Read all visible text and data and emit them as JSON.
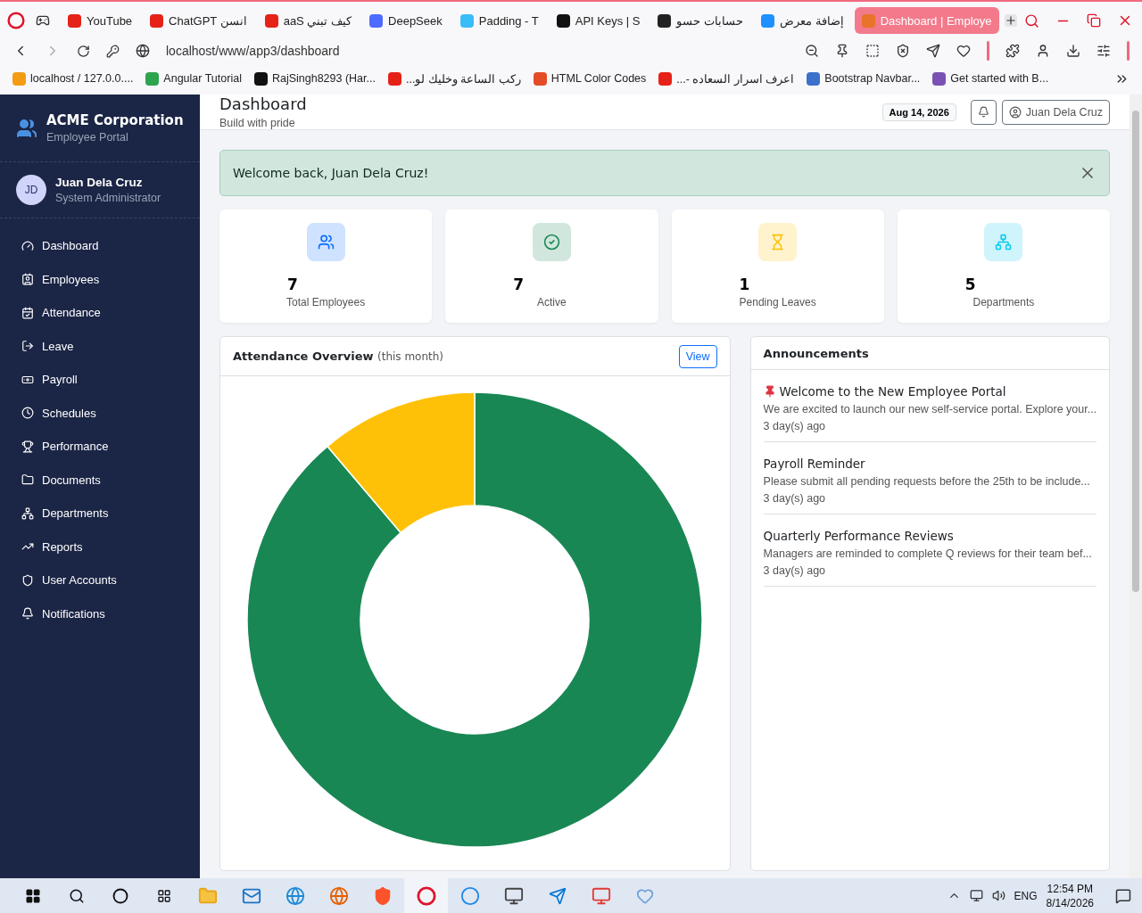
{
  "browser": {
    "tabs": [
      {
        "label": "YouTube",
        "selected": false
      },
      {
        "label": "ChatGPT انسن",
        "selected": false
      },
      {
        "label": "كيف تبني aaS",
        "selected": false
      },
      {
        "label": "DeepSeek",
        "selected": false
      },
      {
        "label": "Padding - T",
        "selected": false
      },
      {
        "label": "API Keys | S",
        "selected": false
      },
      {
        "label": "حسابات حسو",
        "selected": false
      },
      {
        "label": "إضافة معرض",
        "selected": false
      },
      {
        "label": "Dashboard | Employe",
        "selected": true
      }
    ],
    "address": "localhost/www/app3/dashboard",
    "bookmarks": [
      {
        "label": "localhost / 127.0.0...."
      },
      {
        "label": "Angular Tutorial"
      },
      {
        "label": "RajSingh8293 (Har..."
      },
      {
        "label": "ركب الساعة وخليك لو..."
      },
      {
        "label": "HTML Color Codes"
      },
      {
        "label": "اعرف اسرار السعاده -..."
      },
      {
        "label": "Bootstrap Navbar..."
      },
      {
        "label": "Get started with B..."
      }
    ]
  },
  "sidebar": {
    "brand": {
      "name": "ACME Corporation",
      "subtitle": "Employee Portal"
    },
    "user": {
      "initials": "JD",
      "name": "Juan Dela Cruz",
      "role": "System Administrator"
    },
    "nav": [
      {
        "label": "Dashboard"
      },
      {
        "label": "Employees"
      },
      {
        "label": "Attendance"
      },
      {
        "label": "Leave"
      },
      {
        "label": "Payroll"
      },
      {
        "label": "Schedules"
      },
      {
        "label": "Performance"
      },
      {
        "label": "Documents"
      },
      {
        "label": "Departments"
      },
      {
        "label": "Reports"
      },
      {
        "label": "User Accounts"
      },
      {
        "label": "Notifications"
      }
    ]
  },
  "header": {
    "title": "Dashboard",
    "subtitle": "Build with pride",
    "date": "Aug 14, 2026",
    "user_button": "Juan Dela Cruz"
  },
  "alert": {
    "message": "Welcome back, Juan Dela Cruz!"
  },
  "stats": [
    {
      "kind": "people",
      "value": "7",
      "label": "Total Employees",
      "color": "#0d6efd"
    },
    {
      "kind": "check",
      "value": "7",
      "label": "Active",
      "color": "#198754"
    },
    {
      "kind": "hourglass",
      "value": "1",
      "label": "Pending Leaves",
      "color": "#ffc107"
    },
    {
      "kind": "sitemap",
      "value": "5",
      "label": "Departments",
      "color": "#0dcaf0"
    }
  ],
  "attendance": {
    "title": "Attendance Overview",
    "note": "(this month)",
    "button": "View"
  },
  "announcements": {
    "title": "Announcements",
    "items": [
      {
        "pinned": true,
        "title": "Welcome to the New Employee Portal",
        "body": "We are excited to launch our new self-service portal. Explore your...",
        "time": "3 day(s) ago"
      },
      {
        "pinned": false,
        "title": "Payroll Reminder",
        "body": "Please submit all pending requests before the 25th to be include...",
        "time": "3 day(s) ago"
      },
      {
        "pinned": false,
        "title": "Quarterly Performance Reviews",
        "body": "Managers are reminded to complete Q reviews for their team bef...",
        "time": "3 day(s) ago"
      }
    ]
  },
  "taskbar": {
    "language": "ENG",
    "time": "12:54 PM",
    "date": "8/14/2026"
  }
}
